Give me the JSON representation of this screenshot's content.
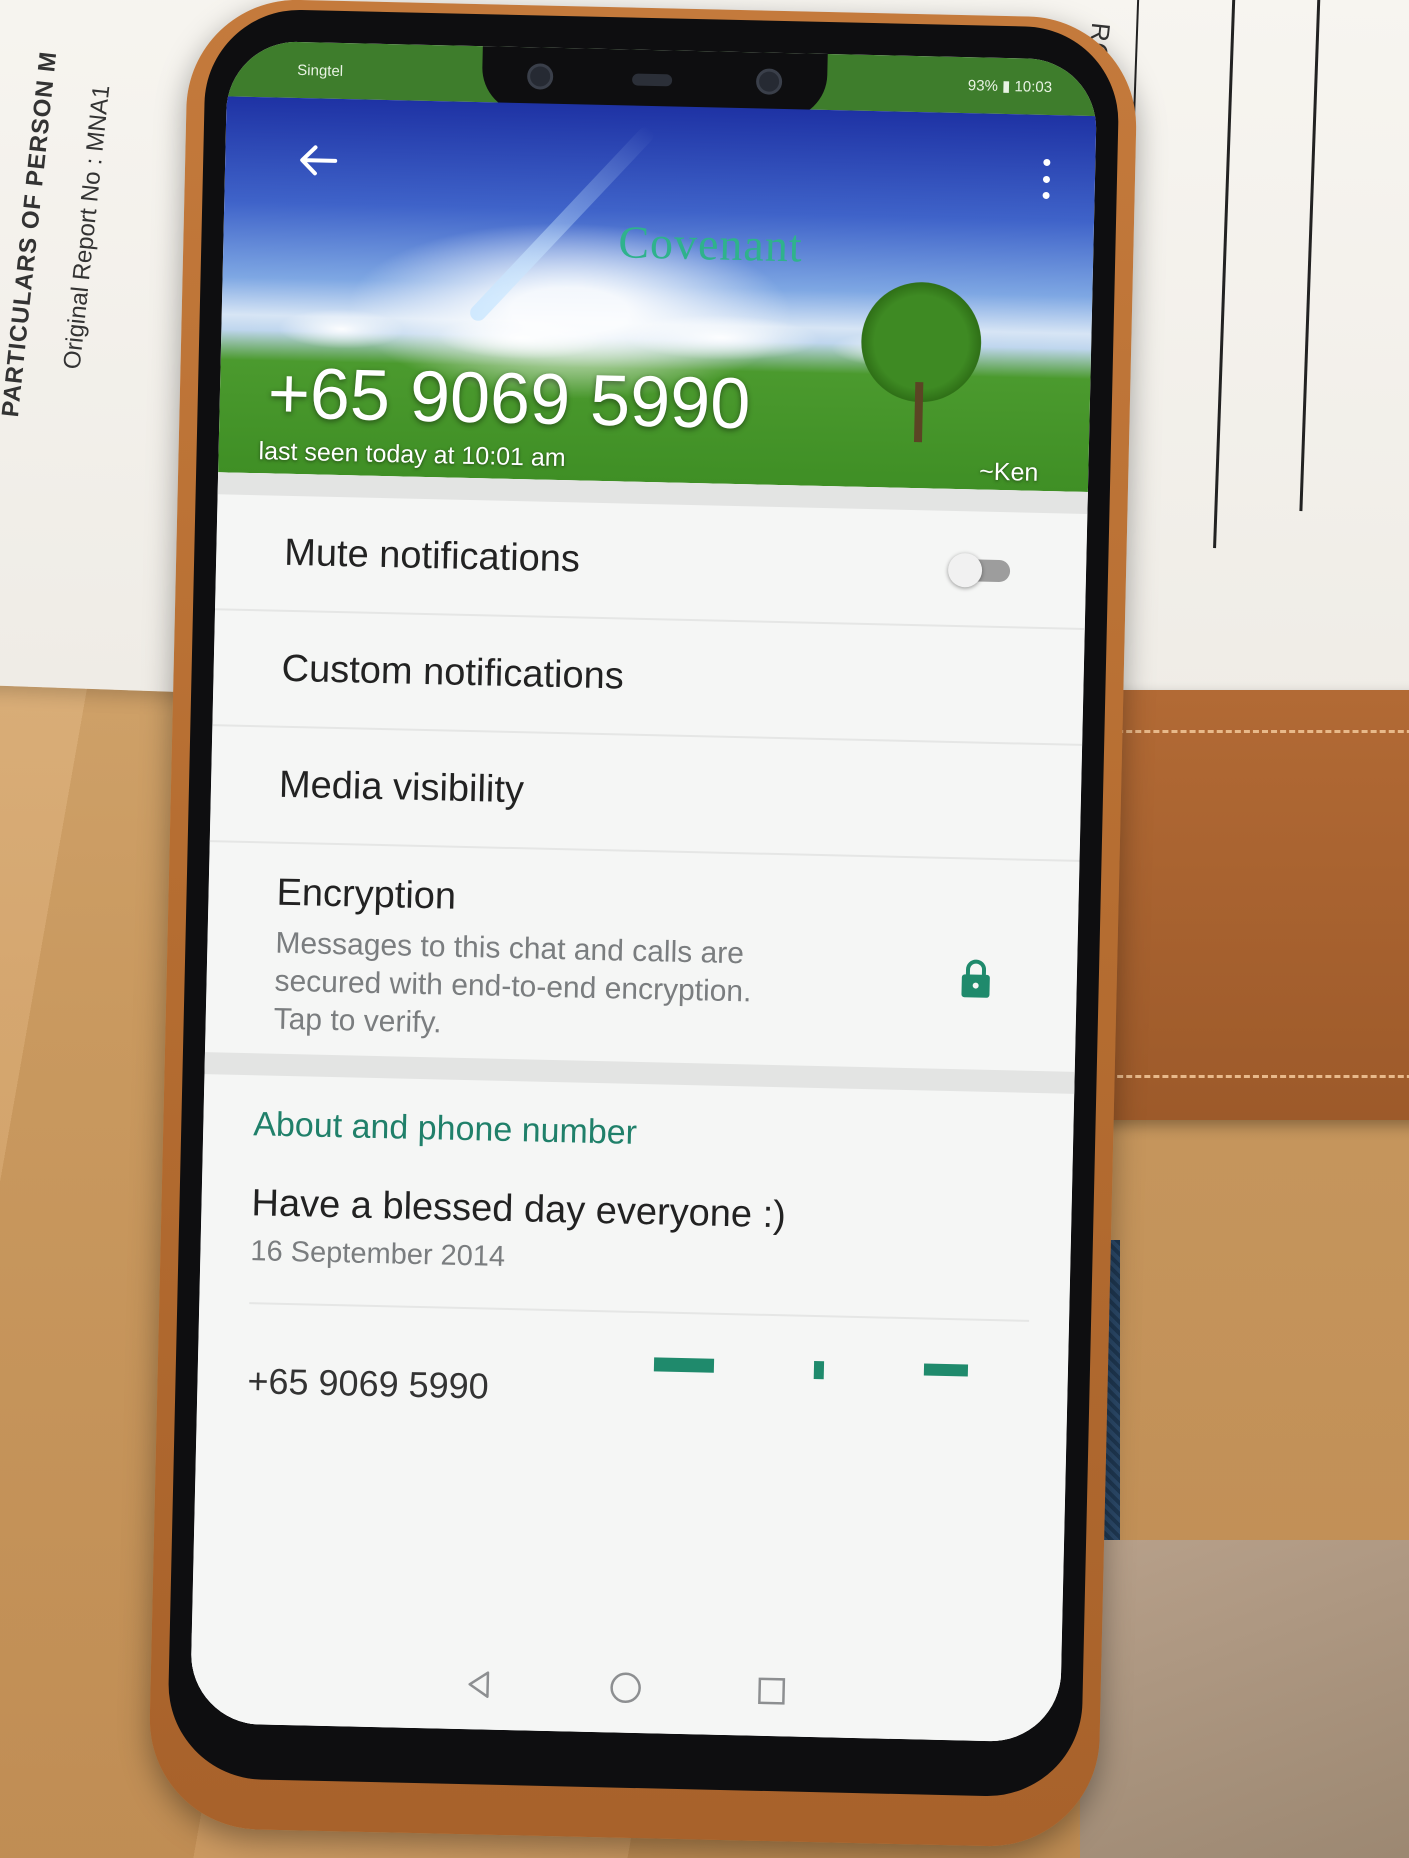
{
  "background": {
    "paper_left_heading": "PARTICULARS OF PERSON M",
    "paper_left_report": "Original Report No  :  MNA1",
    "paper_right_text": "ROM THI"
  },
  "status_bar": {
    "carrier": "Singtel",
    "battery": "93%",
    "time": "10:03"
  },
  "header": {
    "wallpaper_text": "Covenant",
    "contact_number": "+65 9069 5990",
    "last_seen": "last seen today at 10:01 am",
    "push_name": "~Ken"
  },
  "settings": {
    "mute_notifications": "Mute notifications",
    "mute_enabled": false,
    "custom_notifications": "Custom notifications",
    "media_visibility": "Media visibility",
    "encryption_title": "Encryption",
    "encryption_description": "Messages to this chat and calls are secured with end-to-end encryption. Tap to verify."
  },
  "about": {
    "section_title": "About and phone number",
    "status_text": "Have a blessed day everyone :)",
    "status_date": "16 September 2014",
    "partial_number": "+65 9069 5990"
  },
  "colors": {
    "accent": "#20806a",
    "status_bar": "#3e7d2c",
    "wallpaper_text": "#2fb28c"
  },
  "icons": {
    "back": "back-arrow-icon",
    "menu": "more-vert-icon",
    "lock": "lock-icon",
    "nav_back": "triangle-back-icon",
    "nav_home": "circle-home-icon",
    "nav_recent": "square-recent-icon"
  }
}
